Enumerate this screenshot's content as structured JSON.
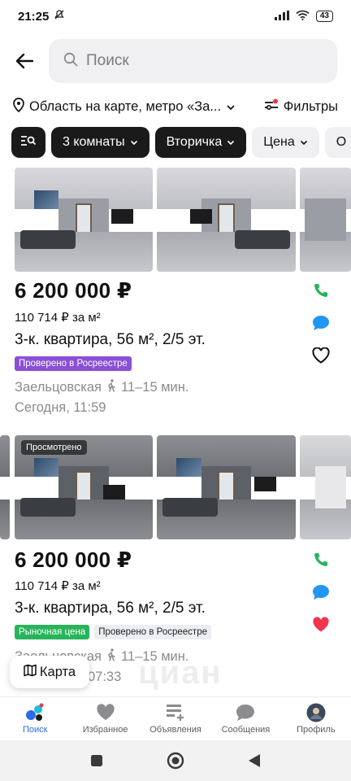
{
  "status": {
    "time": "21:25",
    "battery": "43"
  },
  "search": {
    "placeholder": "Поиск"
  },
  "location": {
    "label": "Область на карте, метро «За...",
    "filters_label": "Фильтры"
  },
  "chips": [
    {
      "label": "3 комнаты"
    },
    {
      "label": "Вторичка"
    },
    {
      "label": "Цена"
    },
    {
      "label": "О"
    }
  ],
  "listings": [
    {
      "price": "6 200 000 ₽",
      "price_per_m2": "110 714 ₽ за м²",
      "title": "3-к. квартира, 56 м², 2/5 эт.",
      "tags": [
        "Проверено в Росреестре"
      ],
      "metro": "Заельцовская",
      "walk": "11–15 мин.",
      "date": "Сегодня, 11:59",
      "favorite": false,
      "viewed": ""
    },
    {
      "price": "6 200 000 ₽",
      "price_per_m2": "110 714 ₽ за м²",
      "title": "3-к. квартира, 56 м², 2/5 эт.",
      "tags": [
        "Рыночная цена",
        "Проверено в Росреестре"
      ],
      "metro": "Заельцовская",
      "walk": "11–15 мин.",
      "date": "07:33",
      "favorite": true,
      "viewed": "Просмотрено"
    }
  ],
  "map_button": {
    "label": "Карта"
  },
  "watermark": "циан",
  "bottom_nav": [
    {
      "label": "Поиск",
      "icon": "search-logo-icon"
    },
    {
      "label": "Избранное",
      "icon": "heart-icon"
    },
    {
      "label": "Объявления",
      "icon": "listings-add-icon"
    },
    {
      "label": "Сообщения",
      "icon": "chat-icon"
    },
    {
      "label": "Профиль",
      "icon": "avatar-icon"
    }
  ],
  "colors": {
    "accent": "#2a6be8",
    "phone": "#27b45a",
    "chat": "#2196f3",
    "heart_active": "#f0364f",
    "tag_purple": "#8a4fd8"
  }
}
